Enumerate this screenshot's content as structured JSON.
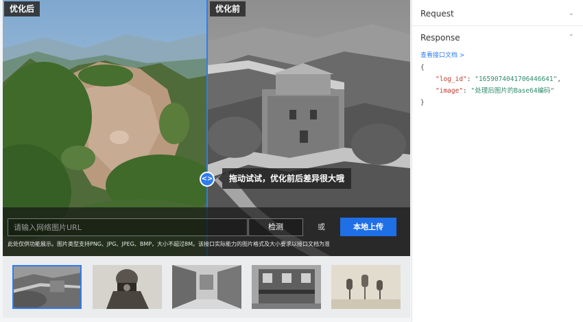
{
  "compare": {
    "after_tag": "优化后",
    "before_tag": "优化前",
    "handle_icon": "<>",
    "tooltip": "拖动试试，优化前后差异很大哦"
  },
  "controls": {
    "url_placeholder": "请输入网络图片URL",
    "detect_label": "检测",
    "or_label": "或",
    "upload_label": "本地上传",
    "note": "此处仅供功能展示。图片类型支持PNG、JPG、JPEG、BMP，大小不超过8M。该接口实际能力的图片格式及大小要求以接口文档为准"
  },
  "thumbnails": [
    {
      "name": "great-wall",
      "selected": true
    },
    {
      "name": "photographer",
      "selected": false
    },
    {
      "name": "street",
      "selected": false
    },
    {
      "name": "building",
      "selected": false
    },
    {
      "name": "microphones",
      "selected": false
    }
  ],
  "panel": {
    "request_label": "Request",
    "response_label": "Response",
    "doc_link": "查看接口文档 >",
    "code": {
      "open": "{",
      "close": "}",
      "log_id_key": "\"log_id\"",
      "log_id_value": "\"1659074041706446641\"",
      "image_key": "\"image\"",
      "image_value": "\"处理后图片的Base64编码\""
    }
  },
  "colors": {
    "accent": "#2f7cf0",
    "upload_button": "#1f6fe6",
    "json_key": "#c0392b",
    "json_value": "#2e8b6e"
  },
  "icons": {
    "request_toggle": "chevron-down-icon",
    "response_toggle": "chevron-up-icon",
    "handle": "drag-handle-icon"
  }
}
